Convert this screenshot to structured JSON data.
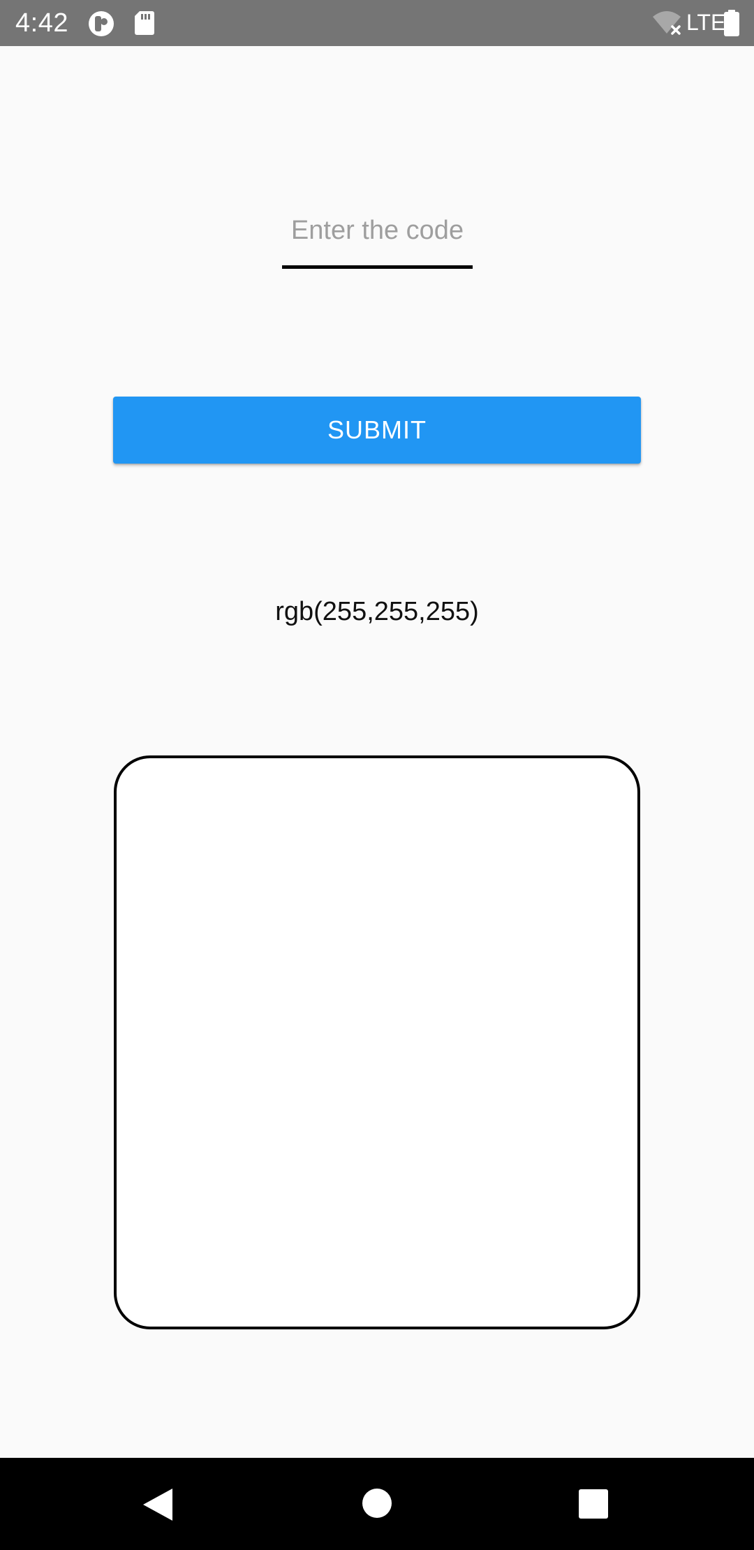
{
  "status_bar": {
    "time": "4:42",
    "network": "LTE",
    "icons": {
      "app_notification": "circle-p-icon",
      "sd_card": "sd-card-icon",
      "wifi": "wifi-off-icon",
      "battery": "battery-full-icon"
    }
  },
  "form": {
    "code_input": {
      "placeholder": "Enter the code",
      "value": ""
    },
    "submit_label": "SUBMIT"
  },
  "result": {
    "color_text": "rgb(255,255,255)",
    "preview_color": "#ffffff"
  },
  "nav_bar": {
    "back": "back-triangle-icon",
    "home": "home-circle-icon",
    "recent": "recent-square-icon"
  },
  "colors": {
    "accent": "#2196f3",
    "status_bar": "#757575",
    "background": "#fafafa",
    "nav_bar": "#000000"
  }
}
